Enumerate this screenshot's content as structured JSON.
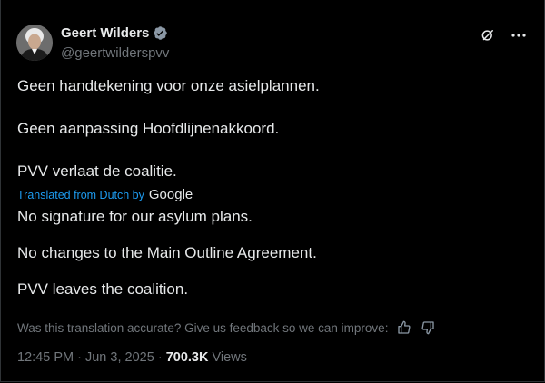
{
  "author": {
    "name": "Geert Wilders",
    "handle": "@geertwilderspvv",
    "verified": true
  },
  "original_text": [
    "Geen handtekening voor onze asielplannen.",
    "Geen aanpassing Hoofdlijnenakkoord.",
    "PVV verlaat de coalitie."
  ],
  "translation": {
    "label": "Translated from Dutch by",
    "provider": "Google",
    "paragraphs": [
      "No signature for our asylum plans.",
      "No changes to the Main Outline Agreement.",
      "PVV leaves the coalition."
    ]
  },
  "feedback": {
    "question": "Was this translation accurate? Give us feedback so we can improve:",
    "icons": [
      "thumbs-up-icon",
      "thumbs-down-icon"
    ]
  },
  "meta": {
    "time": "12:45 PM",
    "separator": "·",
    "date": "Jun 3, 2025",
    "views_count": "700.3K",
    "views_label": "Views"
  },
  "top_actions": {
    "icons": [
      "grok-icon",
      "more-icon"
    ]
  },
  "colors": {
    "background": "#000000",
    "text": "#e7e9ea",
    "secondary": "#71767b",
    "accent": "#1d9bf0"
  }
}
